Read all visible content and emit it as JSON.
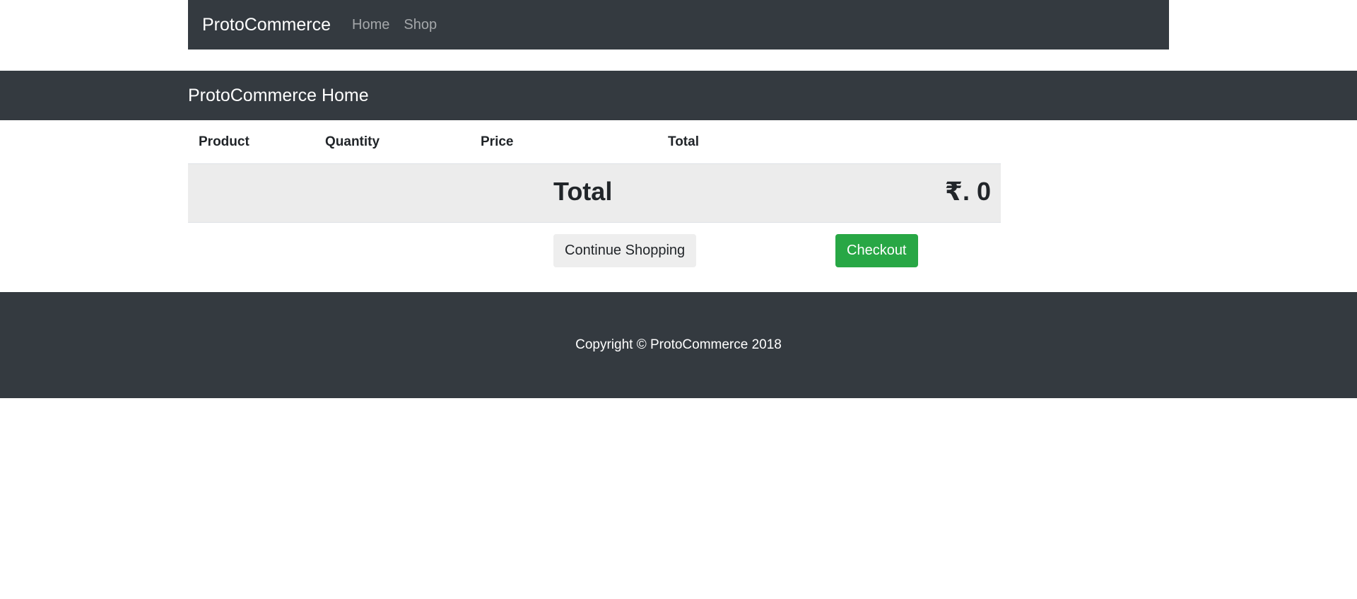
{
  "navbar": {
    "brand": "ProtoCommerce",
    "links": [
      "Home",
      "Shop"
    ]
  },
  "header": {
    "title": "ProtoCommerce Home"
  },
  "cart": {
    "columns": [
      "Product",
      "Quantity",
      "Price",
      "Total"
    ],
    "total_label": "Total",
    "total_value": "₹. 0"
  },
  "actions": {
    "continue_label": "Continue Shopping",
    "checkout_label": "Checkout"
  },
  "footer": {
    "copyright": "Copyright © ProtoCommerce 2018"
  },
  "colors": {
    "dark": "#343a40",
    "success": "#28a745",
    "light_row": "#ececec"
  }
}
